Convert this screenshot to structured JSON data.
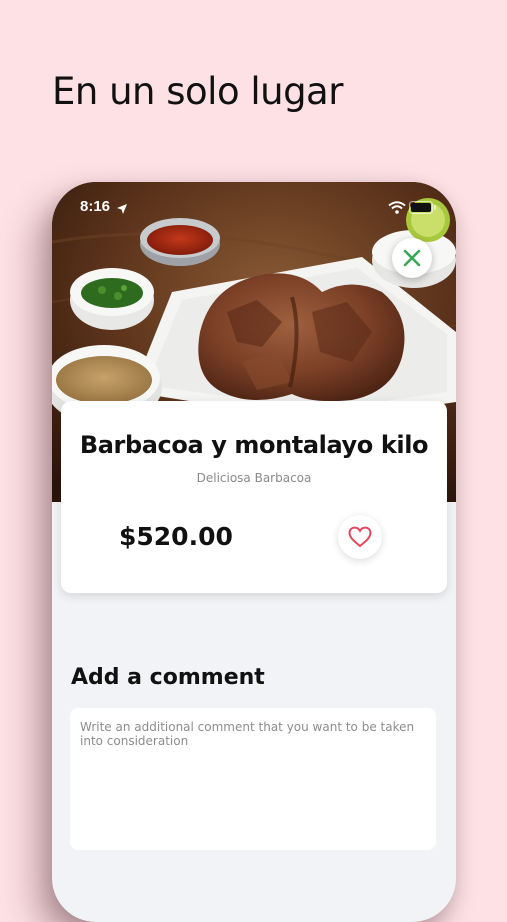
{
  "headline": "En un solo lugar",
  "status_bar": {
    "time": "8:16",
    "location_icon": "location-arrow-icon",
    "wifi_icon": "wifi-icon",
    "battery_icon": "battery-icon"
  },
  "product": {
    "title": "Barbacoa y montalayo kilo",
    "subtitle": "Deliciosa Barbacoa",
    "price": "$520.00",
    "image_description": "barbacoa-dish-photo"
  },
  "actions": {
    "close_icon": "close-icon",
    "favorite_icon": "heart-icon"
  },
  "comment": {
    "heading": "Add a comment",
    "placeholder": "Write an additional comment that you want to be taken into consideration",
    "value": ""
  },
  "colors": {
    "background": "#fde1e5",
    "accent_green": "#3aa856",
    "heart_red": "#e0485f",
    "card": "#ffffff",
    "screen_background": "#f2f3f6"
  }
}
